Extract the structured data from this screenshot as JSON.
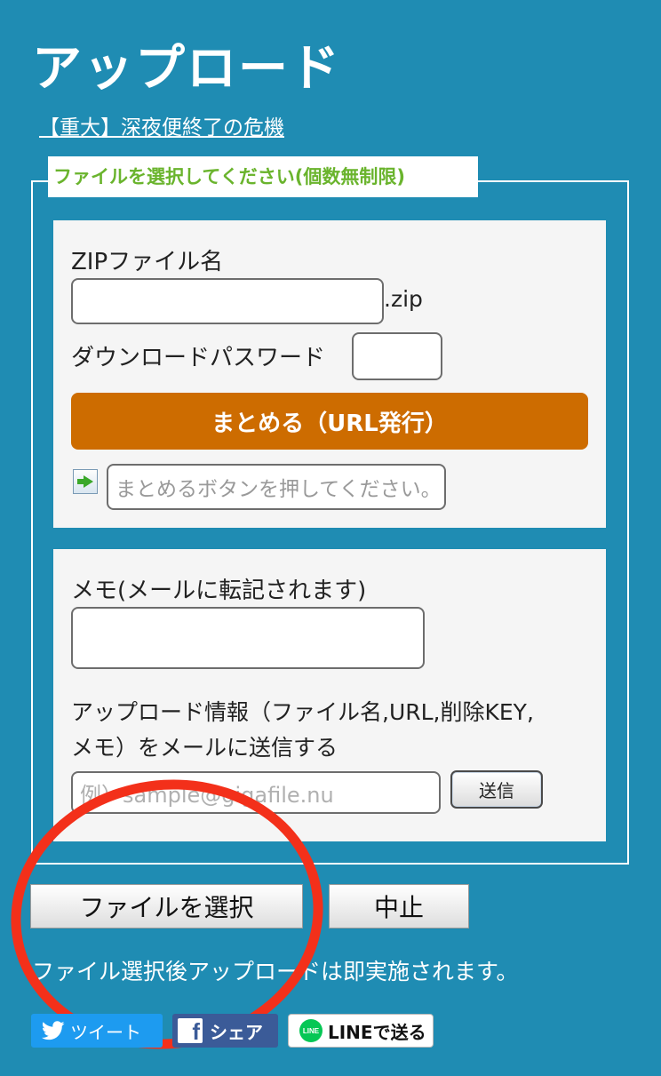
{
  "header": {
    "title": "アップロード",
    "notice_link": "【重大】深夜便終了の危機"
  },
  "fieldset": {
    "legend": "ファイルを選択してください(個数無制限)"
  },
  "zip_panel": {
    "zip_name_label": "ZIPファイル名",
    "zip_name_value": "",
    "zip_suffix": ".zip",
    "password_label": "ダウンロードパスワード",
    "password_value": "",
    "bundle_button": "まとめる（URL発行）",
    "result_placeholder": "まとめるボタンを押してください。"
  },
  "memo_panel": {
    "memo_label": "メモ(メールに転記されます)",
    "memo_value": "",
    "mail_info_line1": "アップロード情報（ファイル名,URL,削除KEY,",
    "mail_info_line2": "メモ）をメールに送信する",
    "email_placeholder": "例）sample@gigafile.nu",
    "send_button": "送信"
  },
  "actions": {
    "select_file_button": "ファイルを選択",
    "stop_button": "中止",
    "note": "ファイル選択後アップロードは即実施されます。"
  },
  "share": {
    "tweet": "ツイート",
    "facebook": "シェア",
    "line": "LINEで送る",
    "line_badge": "LINE",
    "facebook_icon": "f"
  },
  "colors": {
    "background": "#1f8cb3",
    "legend_text": "#6ab42d",
    "bundle_button": "#cd6c00",
    "annotation_circle": "#f3301a"
  }
}
